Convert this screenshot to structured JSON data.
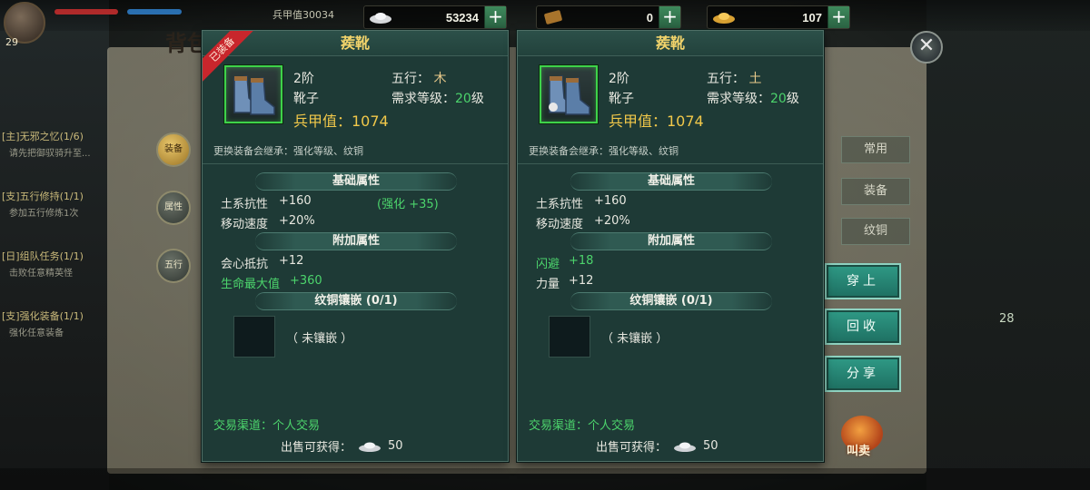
{
  "hud": {
    "player_level": "29",
    "power_label": "兵甲值30034",
    "currencies": [
      {
        "icon": "silver-ingot-icon",
        "value": "53234"
      },
      {
        "icon": "bronze-token-icon",
        "value": "0"
      },
      {
        "icon": "gold-ingot-icon",
        "value": "107"
      }
    ],
    "chat": [
      {
        "title": "[主]无邪之忆(1/6)",
        "sub": "请先把御驭骑升至..."
      },
      {
        "title": "[支]五行修持(1/1)",
        "sub": "参加五行修炼1次"
      },
      {
        "title": "[日]组队任务(1/1)",
        "sub": "击败任意精英怪"
      },
      {
        "title": "[支]强化装备(1/1)",
        "sub": "强化任意装备"
      }
    ]
  },
  "bag": {
    "title": "背包",
    "side_tabs": [
      "装备",
      "属性",
      "五行"
    ],
    "right_tabs": [
      "常用",
      "装备",
      "纹铜"
    ],
    "actions": {
      "equip": "穿上",
      "recycle": "回收",
      "share": "分享",
      "sell": "叫卖"
    },
    "right_level": "28"
  },
  "colors": {
    "panel_bg": "#1e3a36",
    "title_gold": "#f1d36b",
    "green": "#4cd46c",
    "frame_green": "#3ed24a",
    "button_teal": "#2f9a86",
    "ribbon_red": "#c8262c"
  },
  "panels": [
    {
      "equipped_ribbon": "已装备",
      "name": "蒺靴",
      "tier": "2阶",
      "element_label": "五行：",
      "element_glyph": "木",
      "type": "靴子",
      "req_label": "需求等级：",
      "req_value": "20",
      "req_unit": "级",
      "armor": "兵甲值：1074",
      "inherit": "更换装备会继承：强化等级、纹铜",
      "base_title": "基础属性",
      "base": [
        {
          "name": "土系抗性",
          "value": "+160",
          "extra": "(强化 +35)"
        },
        {
          "name": "移动速度",
          "value": "+20%",
          "extra": ""
        }
      ],
      "extra_title": "附加属性",
      "extra": [
        {
          "name": "会心抵抗",
          "value": "+12",
          "green": false
        },
        {
          "name": "生命最大值",
          "value": "+360",
          "green": true
        }
      ],
      "socket_title": "纹铜镶嵌 (0/1)",
      "socket_label": "（ 未镶嵌 ）",
      "trade": "交易渠道：个人交易",
      "sell_label": "出售可获得：",
      "sell_value": "50"
    },
    {
      "equipped_ribbon": "",
      "name": "蒺靴",
      "tier": "2阶",
      "element_label": "五行：",
      "element_glyph": "土",
      "type": "靴子",
      "req_label": "需求等级：",
      "req_value": "20",
      "req_unit": "级",
      "armor": "兵甲值：1074",
      "inherit": "更换装备会继承：强化等级、纹铜",
      "base_title": "基础属性",
      "base": [
        {
          "name": "土系抗性",
          "value": "+160",
          "extra": ""
        },
        {
          "name": "移动速度",
          "value": "+20%",
          "extra": ""
        }
      ],
      "extra_title": "附加属性",
      "extra": [
        {
          "name": "闪避",
          "value": "+18",
          "green": true
        },
        {
          "name": "力量",
          "value": "+12",
          "green": false
        }
      ],
      "socket_title": "纹铜镶嵌 (0/1)",
      "socket_label": "（ 未镶嵌 ）",
      "trade": "交易渠道：个人交易",
      "sell_label": "出售可获得：",
      "sell_value": "50"
    }
  ]
}
